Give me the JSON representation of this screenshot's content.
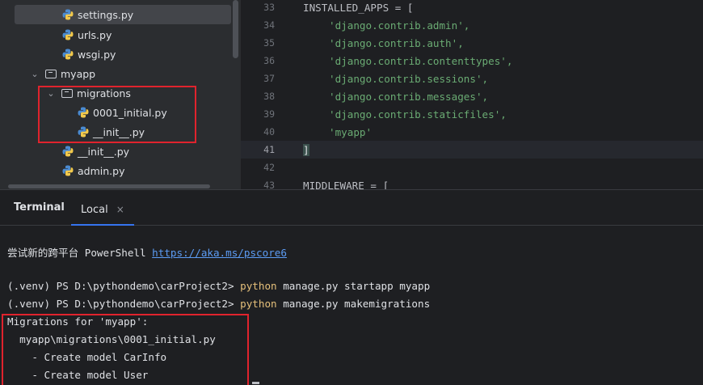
{
  "project_tree": {
    "items": [
      {
        "label": "settings.py",
        "icon": "python-file-icon",
        "selected": true
      },
      {
        "label": "urls.py",
        "icon": "python-file-icon"
      },
      {
        "label": "wsgi.py",
        "icon": "python-file-icon"
      },
      {
        "label": "myapp",
        "icon": "folder-icon",
        "expanded": true
      },
      {
        "label": "migrations",
        "icon": "folder-icon",
        "expanded": true
      },
      {
        "label": "0001_initial.py",
        "icon": "python-file-icon"
      },
      {
        "label": "__init__.py",
        "icon": "python-file-icon"
      },
      {
        "label": "__init__.py",
        "icon": "python-file-icon"
      },
      {
        "label": "admin.py",
        "icon": "python-file-icon"
      }
    ],
    "highlight_color": "#e0232d"
  },
  "editor": {
    "lines": [
      {
        "num": "33",
        "text": "INSTALLED_APPS = ["
      },
      {
        "num": "34",
        "text": "'django.contrib.admin',"
      },
      {
        "num": "35",
        "text": "'django.contrib.auth',"
      },
      {
        "num": "36",
        "text": "'django.contrib.contenttypes',"
      },
      {
        "num": "37",
        "text": "'django.contrib.sessions',"
      },
      {
        "num": "38",
        "text": "'django.contrib.messages',"
      },
      {
        "num": "39",
        "text": "'django.contrib.staticfiles',"
      },
      {
        "num": "40",
        "text": "'myapp'"
      },
      {
        "num": "41",
        "text": "]"
      },
      {
        "num": "42",
        "text": ""
      },
      {
        "num": "43",
        "text": "MIDDLEWARE = ["
      }
    ],
    "string_color": "#6aab73"
  },
  "terminal": {
    "title": "Terminal",
    "tab_label": "Local",
    "tab_close": "×",
    "banner_prefix": "尝试新的跨平台 PowerShell ",
    "banner_link": "https://aka.ms/pscore6",
    "prompt": "(.venv) PS D:\\pythondemo\\carProject2> ",
    "commands": [
      {
        "cmd": "python",
        "args": " manage.py startapp myapp"
      },
      {
        "cmd": "python",
        "args": " manage.py makemigrations"
      }
    ],
    "output": [
      "Migrations for 'myapp':",
      "  myapp\\migrations\\0001_initial.py",
      "    - Create model CarInfo",
      "    - Create model User"
    ]
  }
}
